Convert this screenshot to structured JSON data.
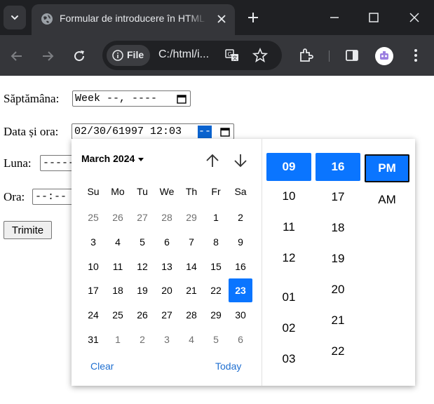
{
  "browser": {
    "tab_title": "Formular de introducere în HTML",
    "site_chip": "File",
    "url": "C:/html/i..."
  },
  "form": {
    "week_label": "Săptămâna:",
    "week_value": "Week --, ----",
    "datetime_label": "Data și ora:",
    "datetime_value": "02/30/61997 12:03",
    "datetime_selected_segment": "--",
    "month_label": "Luna:",
    "month_value": "-----",
    "time_label": "Ora:",
    "time_value": "--:--",
    "submit_label": "Trimite"
  },
  "picker": {
    "month_year": "March 2024",
    "weekdays": [
      "Su",
      "Mo",
      "Tu",
      "We",
      "Th",
      "Fr",
      "Sa"
    ],
    "days": [
      [
        "25",
        "26",
        "27",
        "28",
        "29",
        "1",
        "2"
      ],
      [
        "3",
        "4",
        "5",
        "6",
        "7",
        "8",
        "9"
      ],
      [
        "10",
        "11",
        "12",
        "13",
        "14",
        "15",
        "16"
      ],
      [
        "17",
        "18",
        "19",
        "20",
        "21",
        "22",
        "23"
      ],
      [
        "24",
        "25",
        "26",
        "27",
        "28",
        "29",
        "30"
      ],
      [
        "31",
        "1",
        "2",
        "3",
        "4",
        "5",
        "6"
      ]
    ],
    "selected_day": "23",
    "clear_label": "Clear",
    "today_label": "Today",
    "hours": [
      "09",
      "10",
      "11",
      "12",
      "01",
      "02",
      "03"
    ],
    "selected_hour": "09",
    "minutes": [
      "16",
      "17",
      "18",
      "19",
      "20",
      "21",
      "22"
    ],
    "selected_minute": "16",
    "meridiem": [
      "PM",
      "AM"
    ],
    "selected_meridiem": "PM"
  },
  "colors": {
    "accent": "#0a75ff",
    "chrome_dark": "#1f2023",
    "chrome_toolbar": "#35363a",
    "link": "#1f6fd0"
  }
}
